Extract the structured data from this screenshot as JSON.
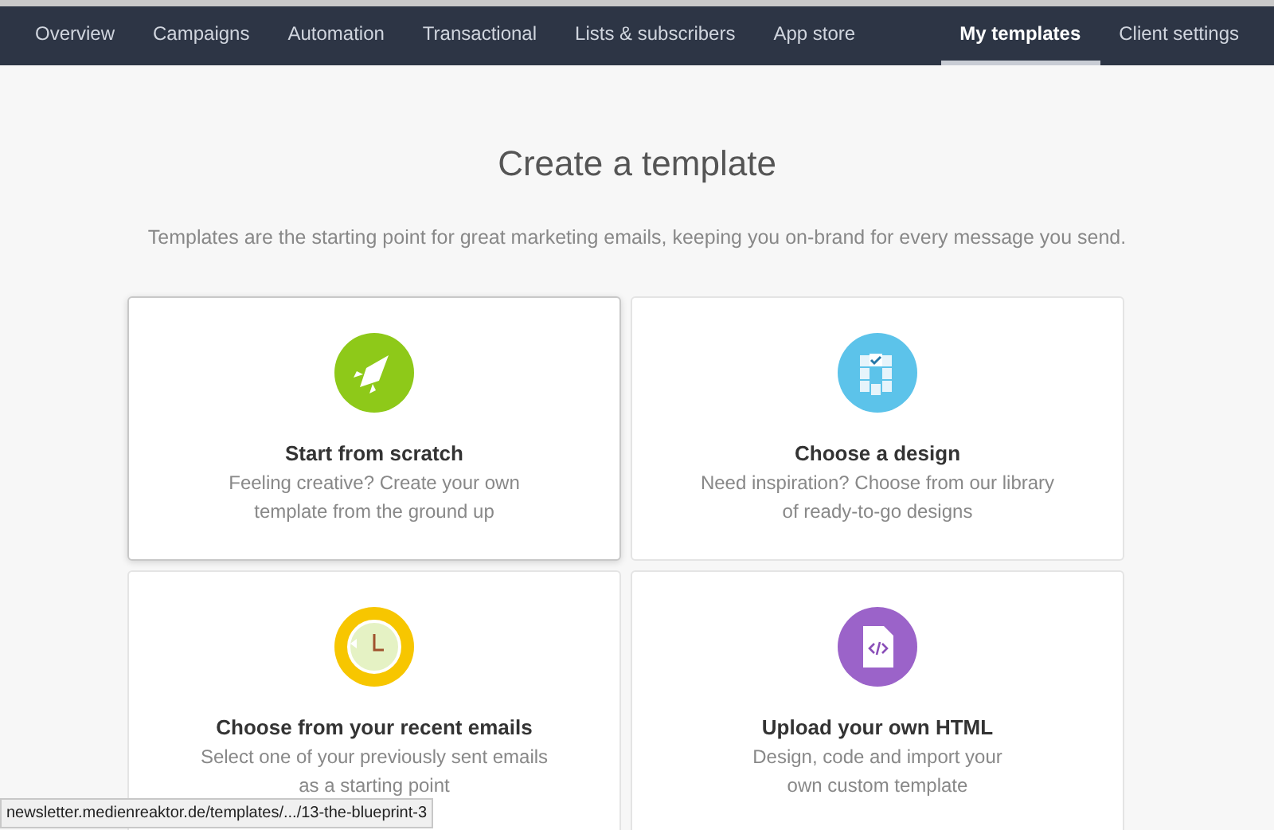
{
  "nav": {
    "left_items": [
      {
        "label": "Overview",
        "selected": false
      },
      {
        "label": "Campaigns",
        "selected": false
      },
      {
        "label": "Automation",
        "selected": false
      },
      {
        "label": "Transactional",
        "selected": false
      },
      {
        "label": "Lists & subscribers",
        "selected": false
      },
      {
        "label": "App store",
        "selected": false
      }
    ],
    "right_items": [
      {
        "label": "My templates",
        "selected": true
      },
      {
        "label": "Client settings",
        "selected": false
      }
    ]
  },
  "heading": "Create a template",
  "intro": "Templates are the starting point for great marketing emails, keeping you on-brand for every message you send.",
  "options": [
    {
      "kind": "rocket",
      "color": "#8ec919",
      "title": "Start from scratch",
      "lines": [
        "Feeling creative? Create your own",
        "template from the ground up"
      ],
      "hovered": true
    },
    {
      "kind": "grid",
      "color": "#5cc3ea",
      "title": "Choose a design",
      "lines": [
        "Need inspiration? Choose from our library",
        "of ready-to-go designs"
      ],
      "hovered": false
    },
    {
      "kind": "clock",
      "color": "#f7c600",
      "title": "Choose from your recent emails",
      "lines": [
        "Select one of your previously sent emails",
        "as a starting point"
      ],
      "hovered": false
    },
    {
      "kind": "html",
      "color": "#9b63c9",
      "title": "Upload your own HTML",
      "lines": [
        "Design, code and import your",
        "own custom template"
      ],
      "hovered": false
    }
  ],
  "status_url": "newsletter.medienreaktor.de/templates/.../13-the-blueprint-3"
}
